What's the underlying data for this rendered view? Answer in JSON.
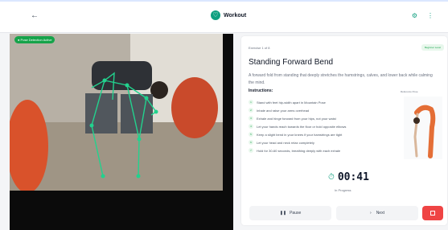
{
  "header": {
    "back_icon": "arrow-left-icon",
    "title": "Workout",
    "brand_icon": "activity-icon",
    "actions": [
      "settings-icon",
      "more-icon"
    ]
  },
  "video": {
    "pose_status": "Pose Detection Active"
  },
  "exercise": {
    "count_label": "Exercise 1 of 8",
    "level": "Beginner Level",
    "title": "Standing Forward Bend",
    "description": "A forward fold from standing that deeply stretches the hamstrings, calves, and lower back while calming the mind.",
    "instructions_title": "Instructions:",
    "instructions": [
      "Stand with feet hip-width apart in Mountain Pose",
      "Inhale and raise your arms overhead",
      "Exhale and hinge forward from your hips, not your waist",
      "Let your hands reach towards the floor or hold opposite elbows",
      "Keep a slight bend in your knees if your hamstrings are tight",
      "Let your head and neck relax completely",
      "Hold for 30-60 seconds, breathing deeply with each exhale"
    ],
    "reference_label": "Reference Pose"
  },
  "timer": {
    "value": "00:41",
    "status": "In Progress"
  },
  "controls": {
    "pause_label": "Pause",
    "next_label": "Next"
  },
  "colors": {
    "accent": "#0f9f7f",
    "pose_badge": "#16a34a",
    "stop_button": "#ef4444",
    "skeleton": "#22d28e"
  }
}
